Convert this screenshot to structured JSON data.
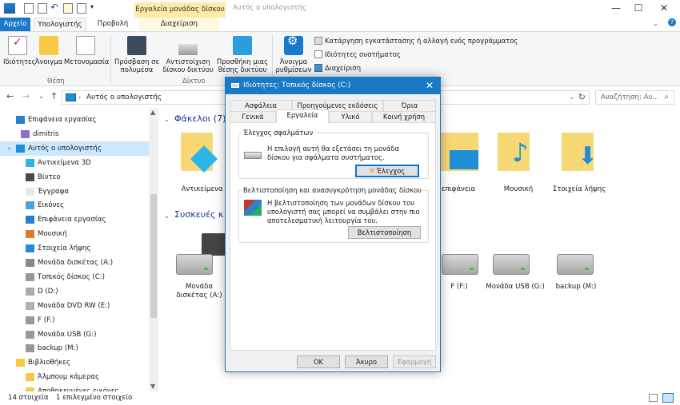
{
  "window": {
    "title": "Αυτός ο υπολογιστής",
    "context_tab": "Εργαλεία μονάδας δίσκου",
    "controls": {
      "minimize": "—",
      "maximize": "☐",
      "close": "✕"
    }
  },
  "ribbon_tabs": {
    "file": "Αρχείο",
    "computer": "Υπολογιστής",
    "view": "Προβολή",
    "manage": "Διαχείριση"
  },
  "ribbon": {
    "location_group": "Θέση",
    "network_group": "Δίκτυο",
    "properties": "Ιδιότητες",
    "open": "Άνοιγμα",
    "rename": "Μετονομασία",
    "access_media_1": "Πρόσβαση σε",
    "access_media_2": "πολυμέσα",
    "map_drive_1": "Αντιστοίχιση",
    "map_drive_2": "δίσκου δικτύου",
    "add_location_1": "Προσθήκη μιας",
    "add_location_2": "θέσης δικτύου",
    "open_settings_1": "Άνοιγμα",
    "open_settings_2": "ρυθμίσεων",
    "uninstall": "Κατάργηση εγκατάστασης ή αλλαγή ενός προγράμματος",
    "system_props": "Ιδιότητες συστήματος",
    "manage": "Διαχείριση"
  },
  "address": {
    "path": "Αυτός ο υπολογιστής",
    "search_placeholder": "Αναζήτηση: Αυ..."
  },
  "nav_pane": {
    "items": [
      {
        "label": "Επιφάνεια εργασίας"
      },
      {
        "label": "dimitris"
      },
      {
        "label": "Αυτός ο υπολογιστής"
      },
      {
        "label": "Αντικείμενα 3D"
      },
      {
        "label": "Βίντεο"
      },
      {
        "label": "Έγγραφα"
      },
      {
        "label": "Εικόνες"
      },
      {
        "label": "Επιφάνεια εργασίας"
      },
      {
        "label": "Μουσική"
      },
      {
        "label": "Στοιχεία λήψης"
      },
      {
        "label": "Μονάδα δισκέτας (A:)"
      },
      {
        "label": "Τοπικός δίσκος (C:)"
      },
      {
        "label": "D (D:)"
      },
      {
        "label": "Μονάδα DVD RW (E:)"
      },
      {
        "label": "F (F:)"
      },
      {
        "label": "Μονάδα USB (G:)"
      },
      {
        "label": "backup (M:)"
      },
      {
        "label": "Βιβλιοθήκες"
      },
      {
        "label": "Άλμπουμ κάμερας"
      },
      {
        "label": "Αποθηκευμένες εικόνες"
      }
    ]
  },
  "content": {
    "folders_header": "Φάκελοι (7)",
    "devices_header": "Συσκευές κ",
    "folders": [
      {
        "label": "Αντικείμενα 3D"
      },
      {
        "label": "επιφάνεια"
      },
      {
        "label": "Μουσική"
      },
      {
        "label": "Στοιχεία λήψης"
      }
    ],
    "drives": [
      {
        "label_1": "Μονάδα",
        "label_2": "δισκέτας (A:)"
      },
      {
        "label_1": "F (F:)"
      },
      {
        "label_1": "Μονάδα USB (G:)"
      },
      {
        "label_1": "backup (M:)"
      }
    ]
  },
  "status": {
    "count": "14 στοιχεία",
    "selected": "1 επιλεγμένο στοιχείο"
  },
  "dialog": {
    "title": "Ιδιότητες: Τοπικός δίσκος (C:)",
    "tabs_row1": [
      "Ασφάλεια",
      "Προηγούμενες εκδόσεις",
      "Όρια"
    ],
    "tabs_row2": [
      "Γενικά",
      "Εργαλεία",
      "Υλικό",
      "Κοινή χρήση"
    ],
    "error_group": "Έλεγχος σφαλμάτων",
    "error_text_1": "Η επιλογή αυτή θα εξετάσει τη μονάδα",
    "error_text_2": "δίσκου για σφάλματα συστήματος.",
    "check_button": "Έλεγχος",
    "optimize_group": "Βελτιστοποίηση και ανασυγκρότηση μονάδας δίσκου",
    "optimize_text_1": "Η βελτιστοποίηση των μονάδων δίσκου του",
    "optimize_text_2": "υπολογιστή σας μπορεί να συμβάλει στην πιο",
    "optimize_text_3": "αποτελεσματική λειτουργία του.",
    "optimize_button": "Βελτιστοποίηση",
    "ok": "OK",
    "cancel": "Άκυρο",
    "apply": "Εφαρμογή"
  }
}
